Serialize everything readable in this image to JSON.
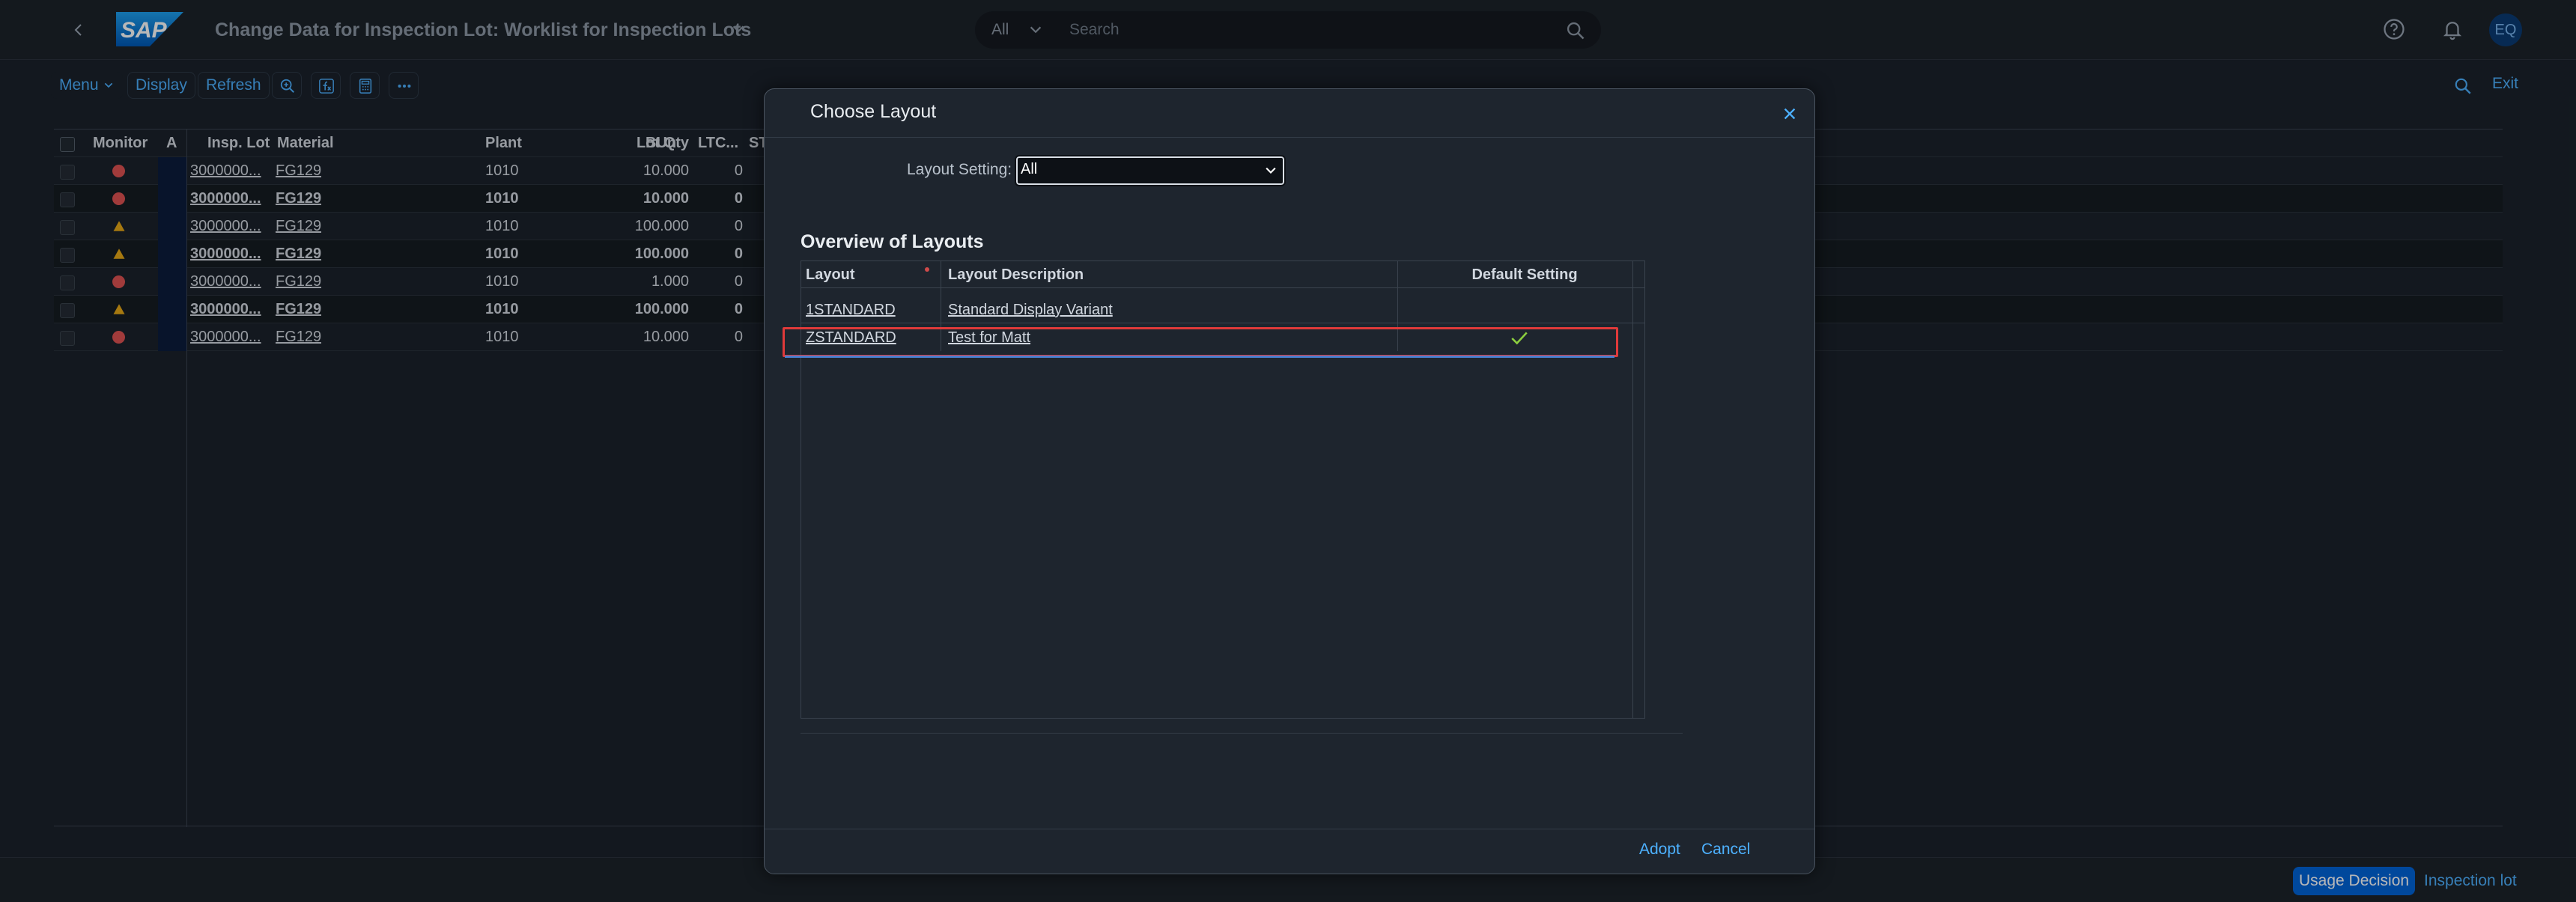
{
  "shell": {
    "title": "Change Data for Inspection Lot: Worklist for Inspection Lots",
    "logo_text": "SAP",
    "search_scope": "All",
    "search_placeholder": "Search",
    "avatar": "EQ"
  },
  "toolbar": {
    "menu": "Menu",
    "display": "Display",
    "refresh": "Refresh",
    "exit": "Exit"
  },
  "table": {
    "columns": [
      "Monitor",
      "A",
      "Insp. Lot",
      "Material",
      "Plant",
      "Lot Qty",
      "BUn",
      "LTC...",
      "ST"
    ],
    "rows": [
      {
        "status": "red",
        "lot": "3000000...",
        "material": "FG129",
        "plant": "1010",
        "qty": "10.000",
        "ltc": "0",
        "bold": false
      },
      {
        "status": "red",
        "lot": "3000000...",
        "material": "FG129",
        "plant": "1010",
        "qty": "10.000",
        "ltc": "0",
        "bold": true
      },
      {
        "status": "yellow",
        "lot": "3000000...",
        "material": "FG129",
        "plant": "1010",
        "qty": "100.000",
        "ltc": "0",
        "bold": false
      },
      {
        "status": "yellow",
        "lot": "3000000...",
        "material": "FG129",
        "plant": "1010",
        "qty": "100.000",
        "ltc": "0",
        "bold": true
      },
      {
        "status": "red",
        "lot": "3000000...",
        "material": "FG129",
        "plant": "1010",
        "qty": "1.000",
        "ltc": "0",
        "bold": false
      },
      {
        "status": "yellow",
        "lot": "3000000...",
        "material": "FG129",
        "plant": "1010",
        "qty": "100.000",
        "ltc": "0",
        "bold": true
      },
      {
        "status": "red",
        "lot": "3000000...",
        "material": "FG129",
        "plant": "1010",
        "qty": "10.000",
        "ltc": "0",
        "bold": false
      }
    ]
  },
  "dialog": {
    "title": "Choose Layout",
    "layout_setting_label": "Layout Setting:",
    "layout_setting_value": "All",
    "overview_title": "Overview of Layouts",
    "columns": [
      "Layout",
      "Layout Description",
      "Default Setting"
    ],
    "rows": [
      {
        "layout": "1STANDARD",
        "description": "Standard Display Variant",
        "default": false
      },
      {
        "layout": "ZSTANDARD",
        "description": "Test for Matt",
        "default": true
      }
    ],
    "adopt": "Adopt",
    "cancel": "Cancel"
  },
  "footer": {
    "usage_decision": "Usage Decision",
    "inspection_lot": "Inspection lot"
  },
  "colors": {
    "accent": "#4db1ff",
    "primary_button": "#0064d9",
    "status_red": "#e05252",
    "status_yellow": "#e6a817",
    "check_green": "#8ccf3f",
    "selection_outline": "#e03a3a"
  }
}
